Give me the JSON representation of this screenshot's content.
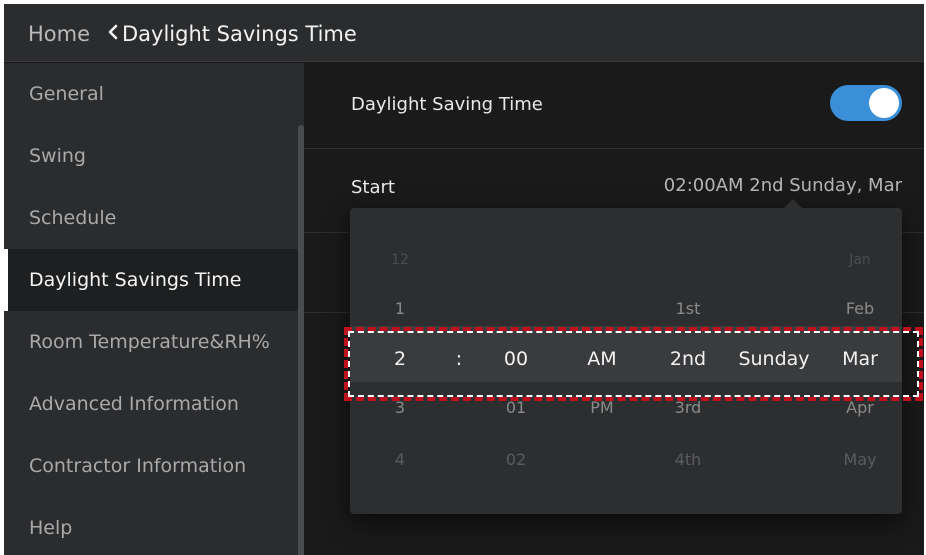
{
  "header": {
    "home_label": "Home",
    "title": "Daylight Savings Time"
  },
  "sidebar": {
    "items": [
      {
        "label": "General"
      },
      {
        "label": "Swing"
      },
      {
        "label": "Schedule"
      },
      {
        "label": "Daylight Savings Time",
        "active": true
      },
      {
        "label": "Room Temperature&RH%"
      },
      {
        "label": "Advanced Information"
      },
      {
        "label": "Contractor Information"
      },
      {
        "label": "Help"
      }
    ]
  },
  "main": {
    "dst_label": "Daylight Saving Time",
    "dst_enabled": true,
    "start_label": "Start",
    "start_value": "02:00AM 2nd Sunday, Mar"
  },
  "picker": {
    "separator": ":",
    "hour": [
      "12",
      "1",
      "2",
      "3",
      "4"
    ],
    "minute": [
      "",
      "",
      "00",
      "01",
      "02"
    ],
    "ampm": [
      "",
      "",
      "AM",
      "PM",
      ""
    ],
    "ordinal": [
      "",
      "1st",
      "2nd",
      "3rd",
      "4th"
    ],
    "weekday": [
      "",
      "",
      "Sunday",
      "",
      ""
    ],
    "month": [
      "Jan",
      "Feb",
      "Mar",
      "Apr",
      "May"
    ]
  },
  "colors": {
    "accent": "#3b8fd8",
    "highlight_border": "#c0101d"
  }
}
